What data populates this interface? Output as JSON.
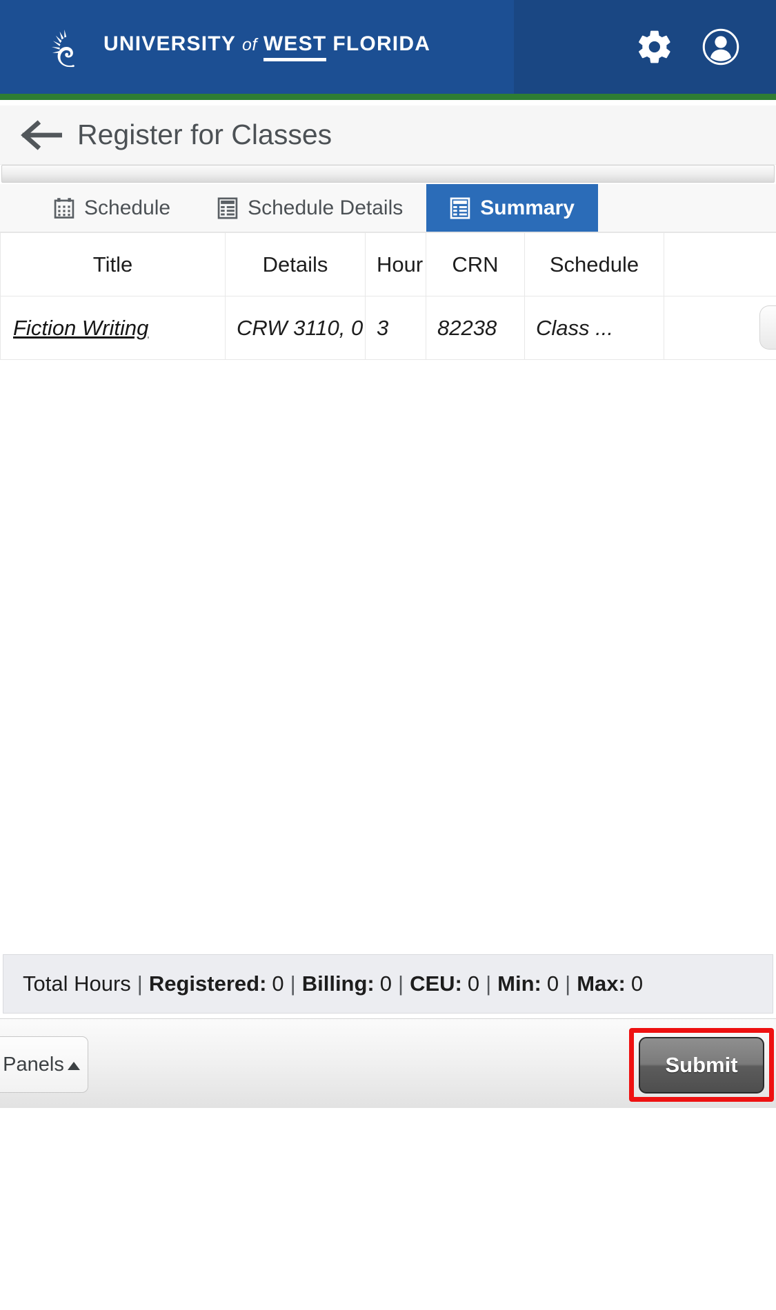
{
  "header": {
    "brand_part1": "UNIVERSITY",
    "brand_of": "of",
    "brand_part2": "WEST",
    "brand_part3": "FLORIDA",
    "logo_icon": "nautilus-shell-icon",
    "settings_icon": "gear-icon",
    "account_icon": "user-avatar-icon",
    "bg_color": "#1c4f93",
    "accent_color": "#2e7d33"
  },
  "title_bar": {
    "back_icon": "back-arrow-icon",
    "title": "Register for Classes"
  },
  "tabs": [
    {
      "label": "Schedule",
      "icon": "calendar-icon",
      "active": false
    },
    {
      "label": "Schedule Details",
      "icon": "list-table-icon",
      "active": false
    },
    {
      "label": "Summary",
      "icon": "summary-table-icon",
      "active": true
    }
  ],
  "table": {
    "columns": [
      "Title",
      "Details",
      "Hour",
      "CRN",
      "Schedule",
      ""
    ],
    "rows": [
      {
        "title": "Fiction Writing",
        "details": "CRW 3110, 0",
        "hours": "3",
        "crn": "82238",
        "schedule": "Class ...",
        "extra": ""
      }
    ]
  },
  "totals": {
    "prefix": "Total Hours",
    "items": [
      {
        "label": "Registered:",
        "value": "0"
      },
      {
        "label": "Billing:",
        "value": "0"
      },
      {
        "label": "CEU:",
        "value": "0"
      },
      {
        "label": "Min:",
        "value": "0"
      },
      {
        "label": "Max:",
        "value": "0"
      }
    ],
    "separator": "|"
  },
  "action_bar": {
    "panels_label": "Panels",
    "panels_caret": "caret-up-icon",
    "submit_label": "Submit",
    "highlight_color": "#ee1111"
  }
}
